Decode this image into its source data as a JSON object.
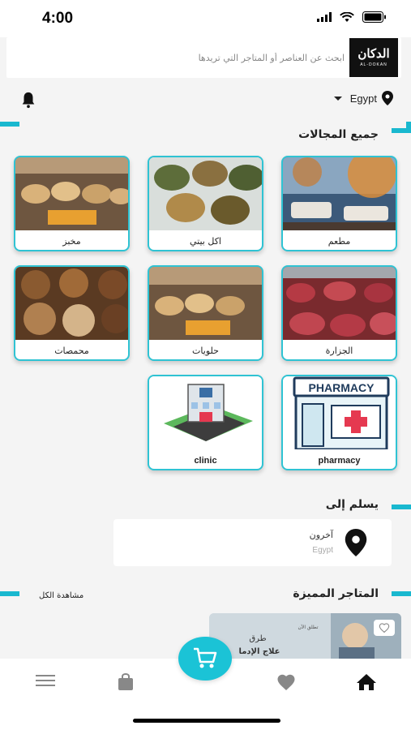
{
  "status_bar": {
    "time": "4:00"
  },
  "search": {
    "placeholder": "ابحث عن العناصر أو المتاجر التي تريدها"
  },
  "logo": {
    "main": "الدكان",
    "sub": "AL-DOKAN"
  },
  "location": {
    "country": "Egypt"
  },
  "categories_section": {
    "title": "جميع المجالات"
  },
  "categories": [
    {
      "label": "مطعم",
      "image": "restaurant"
    },
    {
      "label": "اكل بيتي",
      "image": "home-food"
    },
    {
      "label": "مخبز",
      "image": "bakery"
    },
    {
      "label": "الجزارة",
      "image": "butcher"
    },
    {
      "label": "حلويات",
      "image": "sweets"
    },
    {
      "label": "محمصات",
      "image": "roastery"
    },
    {
      "label": "pharmacy",
      "image": "pharmacy"
    },
    {
      "label": "clinic",
      "image": "clinic"
    }
  ],
  "deliver_section": {
    "title": "يسلم إلى",
    "name": "آخرون",
    "country": "Egypt"
  },
  "featured_section": {
    "title": "المتاجر المميزة",
    "view_all": "مشاهدة الكل"
  },
  "featured_store": {
    "banner_line1": "طرق",
    "banner_line2": "علاج الإدما",
    "banner_tag": "تطلق الآن"
  },
  "colors": {
    "accent": "#19b8cf",
    "fab": "#1bc3d6"
  },
  "icons": [
    "wifi-icon",
    "battery-icon",
    "signal-icon",
    "bell-icon",
    "location-pin-icon",
    "cart-icon",
    "home-icon",
    "heart-icon",
    "bag-icon",
    "menu-icon"
  ]
}
